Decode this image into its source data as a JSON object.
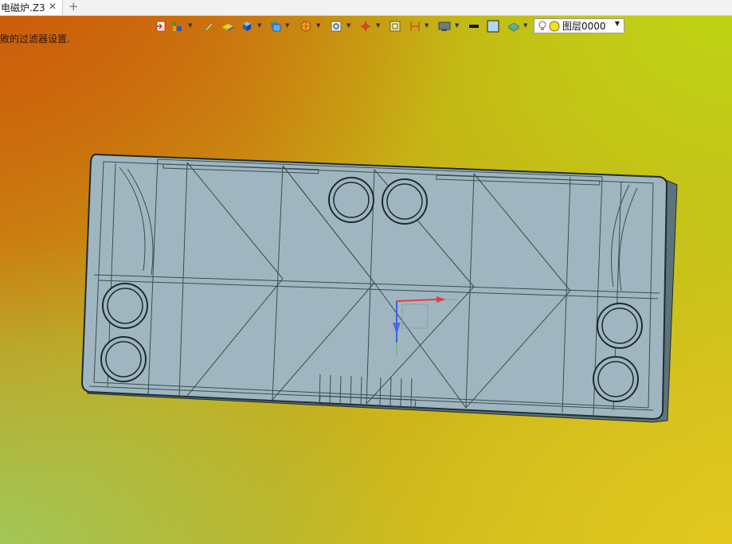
{
  "tab": {
    "title": "电磁炉.Z3",
    "close": "✕",
    "add": "+"
  },
  "hint_text": "敗的过滤器设置.",
  "toolbar": {
    "buttons": [
      {
        "name": "exit-icon",
        "has_dropdown": false
      },
      {
        "name": "insert-component-icon",
        "has_dropdown": true
      },
      {
        "name": "pen-icon",
        "has_dropdown": false
      },
      {
        "name": "solid-shape-icon",
        "has_dropdown": false
      },
      {
        "name": "cube-icon",
        "has_dropdown": true
      },
      {
        "name": "views-icon",
        "has_dropdown": true
      },
      {
        "name": "render-mode-icon",
        "has_dropdown": true
      },
      {
        "name": "zoom-fit-icon",
        "has_dropdown": true
      },
      {
        "name": "triad-icon",
        "has_dropdown": true
      },
      {
        "name": "frame-icon",
        "has_dropdown": false
      },
      {
        "name": "section-icon",
        "has_dropdown": true
      },
      {
        "name": "display-icon",
        "has_dropdown": true
      },
      {
        "name": "line-color-icon",
        "has_dropdown": false
      },
      {
        "name": "face-color-icon",
        "has_dropdown": false
      },
      {
        "name": "layer-manager-icon",
        "has_dropdown": true
      }
    ]
  },
  "layer": {
    "value": "图层0000",
    "dropdown": "▼"
  },
  "colors": {
    "part_fill": "#9fb6c0",
    "part_edge": "#1f2b30",
    "axis_x": "#e04040",
    "axis_y": "#40c040",
    "axis_z": "#4060e0"
  }
}
